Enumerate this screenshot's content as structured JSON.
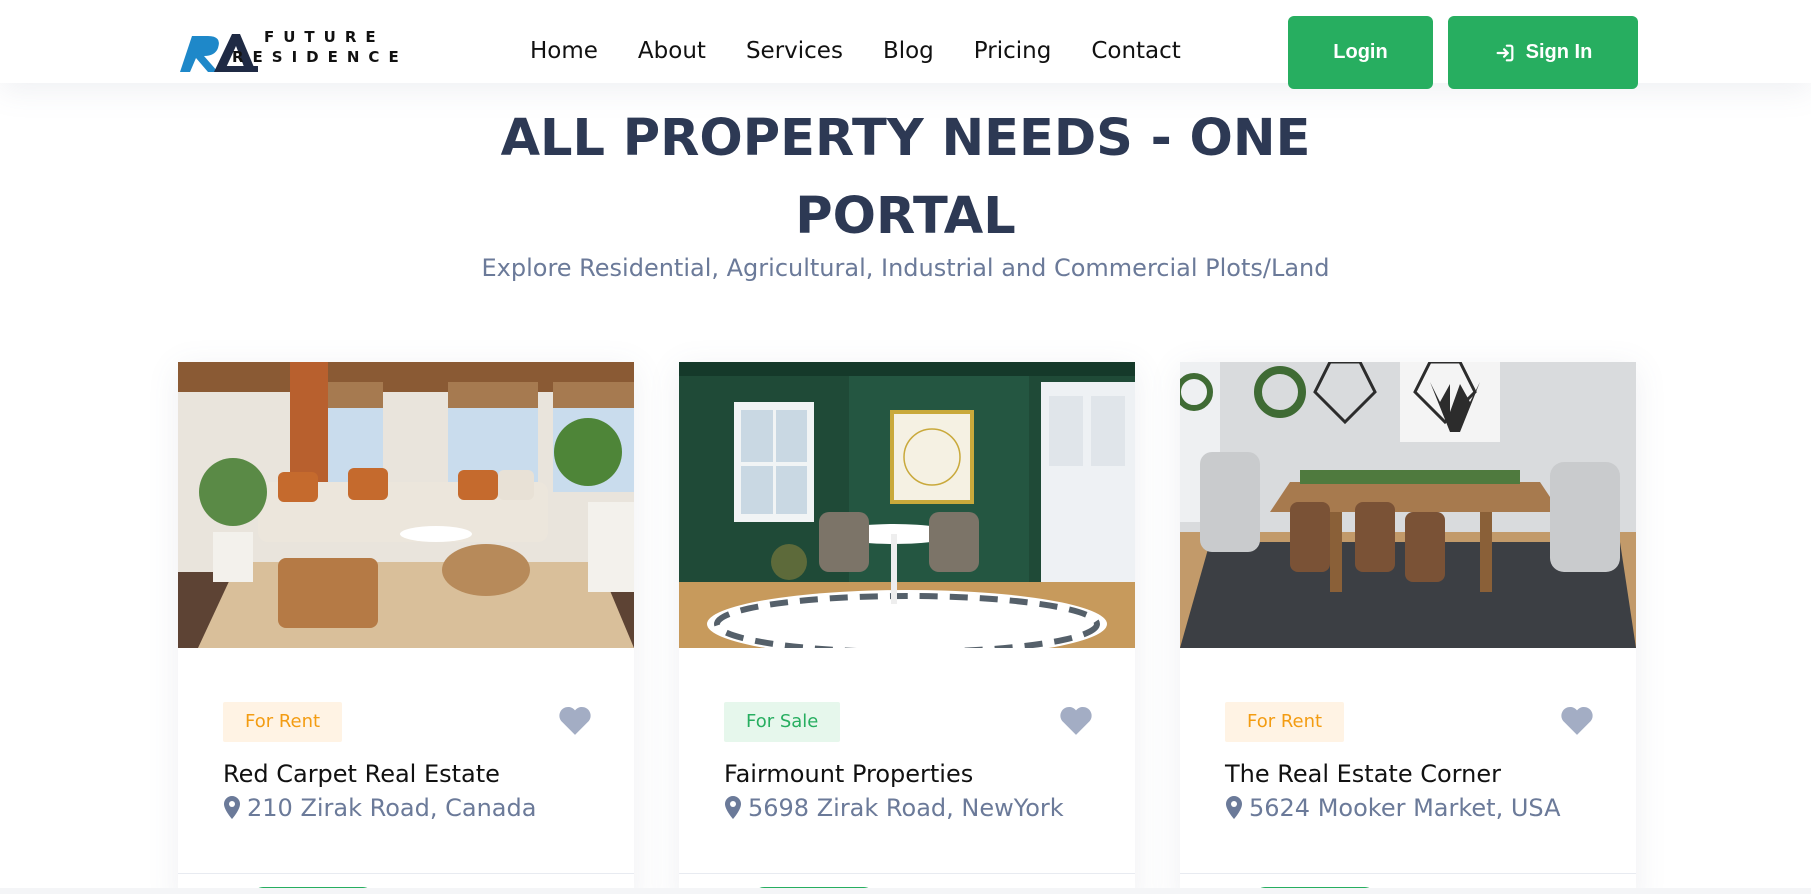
{
  "brand": {
    "line1": "FUTURE",
    "line2": "RESIDENCE",
    "colors": {
      "mark_blue": "#1e88c9",
      "mark_dark": "#1f2a44"
    }
  },
  "nav": {
    "items": [
      "Home",
      "About",
      "Services",
      "Blog",
      "Pricing",
      "Contact"
    ]
  },
  "auth": {
    "login_label": "Login",
    "signin_label": "Sign In",
    "accent": "#27ae60"
  },
  "hero": {
    "title_line1": "ALL PROPERTY NEEDS - ONE",
    "title_line2": "PORTAL",
    "subtitle": "Explore Residential, Agricultural, Industrial and Commercial Plots/Land"
  },
  "listings": [
    {
      "status": "For Rent",
      "name": "Red Carpet Real Estate",
      "location": "210 Zirak Road, Canada"
    },
    {
      "status": "For Sale",
      "name": "Fairmount Properties",
      "location": "5698 Zirak Road, NewYork"
    },
    {
      "status": "For Rent",
      "name": "The Real Estate Corner",
      "location": "5624 Mooker Market, USA"
    }
  ],
  "icons": {
    "favorite": "heart-icon",
    "location": "map-pin-icon",
    "signin": "sign-in-icon"
  }
}
